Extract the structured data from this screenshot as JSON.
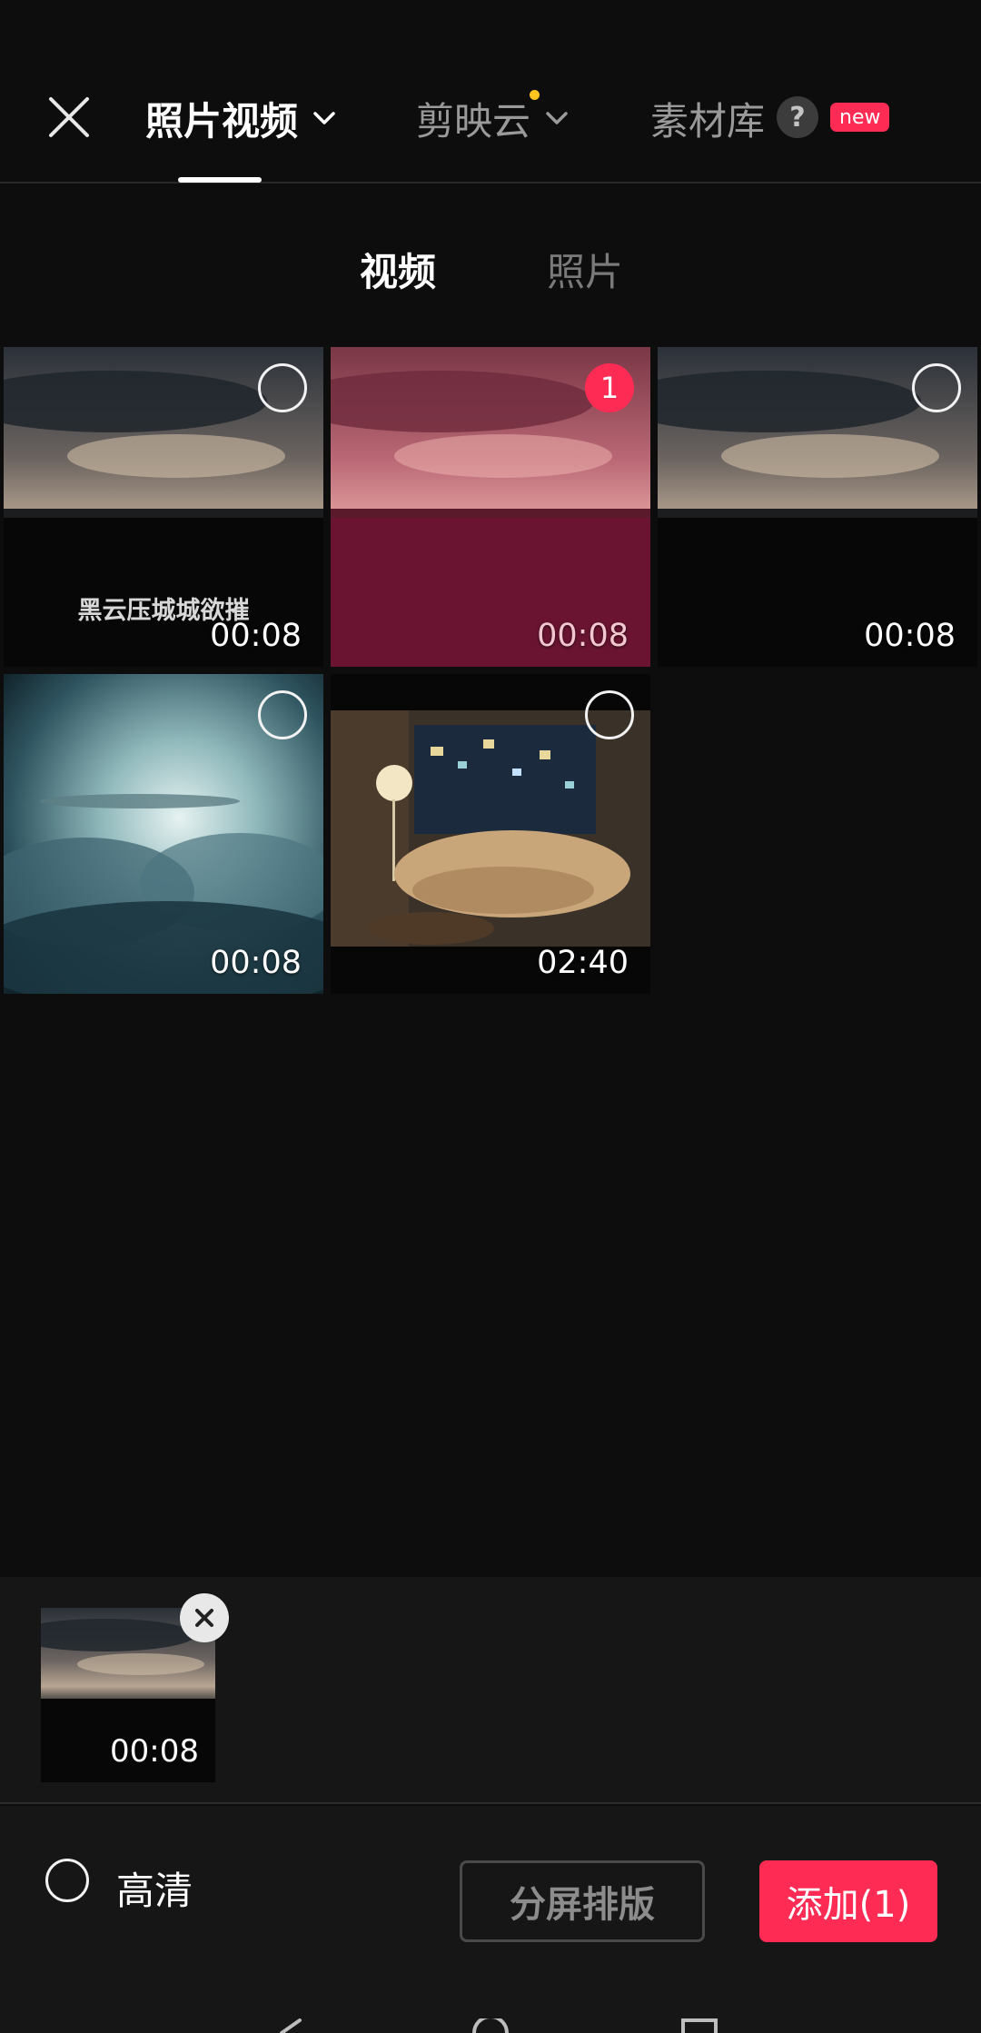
{
  "header": {
    "tabs": [
      {
        "label": "照片视频",
        "active": true
      },
      {
        "label": "剪映云",
        "active": false,
        "has_dot": true
      },
      {
        "label": "素材库",
        "active": false
      }
    ],
    "help_label": "?",
    "new_badge": "new"
  },
  "subtabs": [
    {
      "label": "视频",
      "active": true
    },
    {
      "label": "照片",
      "active": false
    }
  ],
  "media": [
    {
      "duration": "00:08",
      "caption": "黑云压城城欲摧",
      "selected": false,
      "icon": "dark-clouds-thumbnail"
    },
    {
      "duration": "00:08",
      "selected": true,
      "selection_number": "1",
      "icon": "pink-clouds-thumbnail"
    },
    {
      "duration": "00:08",
      "selected": false,
      "icon": "dark-clouds-thumbnail"
    },
    {
      "duration": "00:08",
      "selected": false,
      "icon": "blue-clouds-thumbnail"
    },
    {
      "duration": "02:40",
      "selected": false,
      "icon": "living-room-thumbnail"
    }
  ],
  "tray": {
    "items": [
      {
        "duration": "00:08"
      }
    ]
  },
  "footer": {
    "hd_label": "高清",
    "split_label": "分屏排版",
    "add_label": "添加(1)"
  },
  "colors": {
    "accent": "#fe2c55",
    "dot": "#ffc41f",
    "background": "#0d0d0d"
  }
}
